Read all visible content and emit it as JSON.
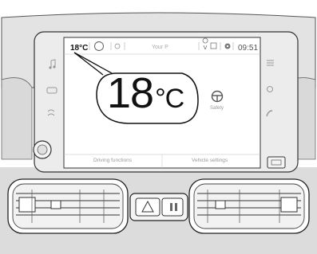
{
  "status_bar": {
    "temperature": "18°C",
    "profile_name": "Your P",
    "clock": "09:51"
  },
  "callout": {
    "value": "18",
    "unit": "°C"
  },
  "home_screen": {
    "app_label": "Safety",
    "app_icon": "steering-wheel-icon"
  },
  "bottom_bar": {
    "left_label": "Driving functions",
    "right_label": "Vehicle settings"
  },
  "icons": {
    "status_bar": [
      "circle-icon",
      "fan-icon",
      "location-pin-icon",
      "phone-icon",
      "gear-icon"
    ],
    "left_panel": [
      "music-note-icon",
      "car-icon",
      "climate-icon"
    ],
    "right_panel": [
      "menu-icon",
      "circle-icon",
      "phone-icon"
    ],
    "center_console": [
      "hazard-warning-icon",
      "lock-icon"
    ]
  }
}
